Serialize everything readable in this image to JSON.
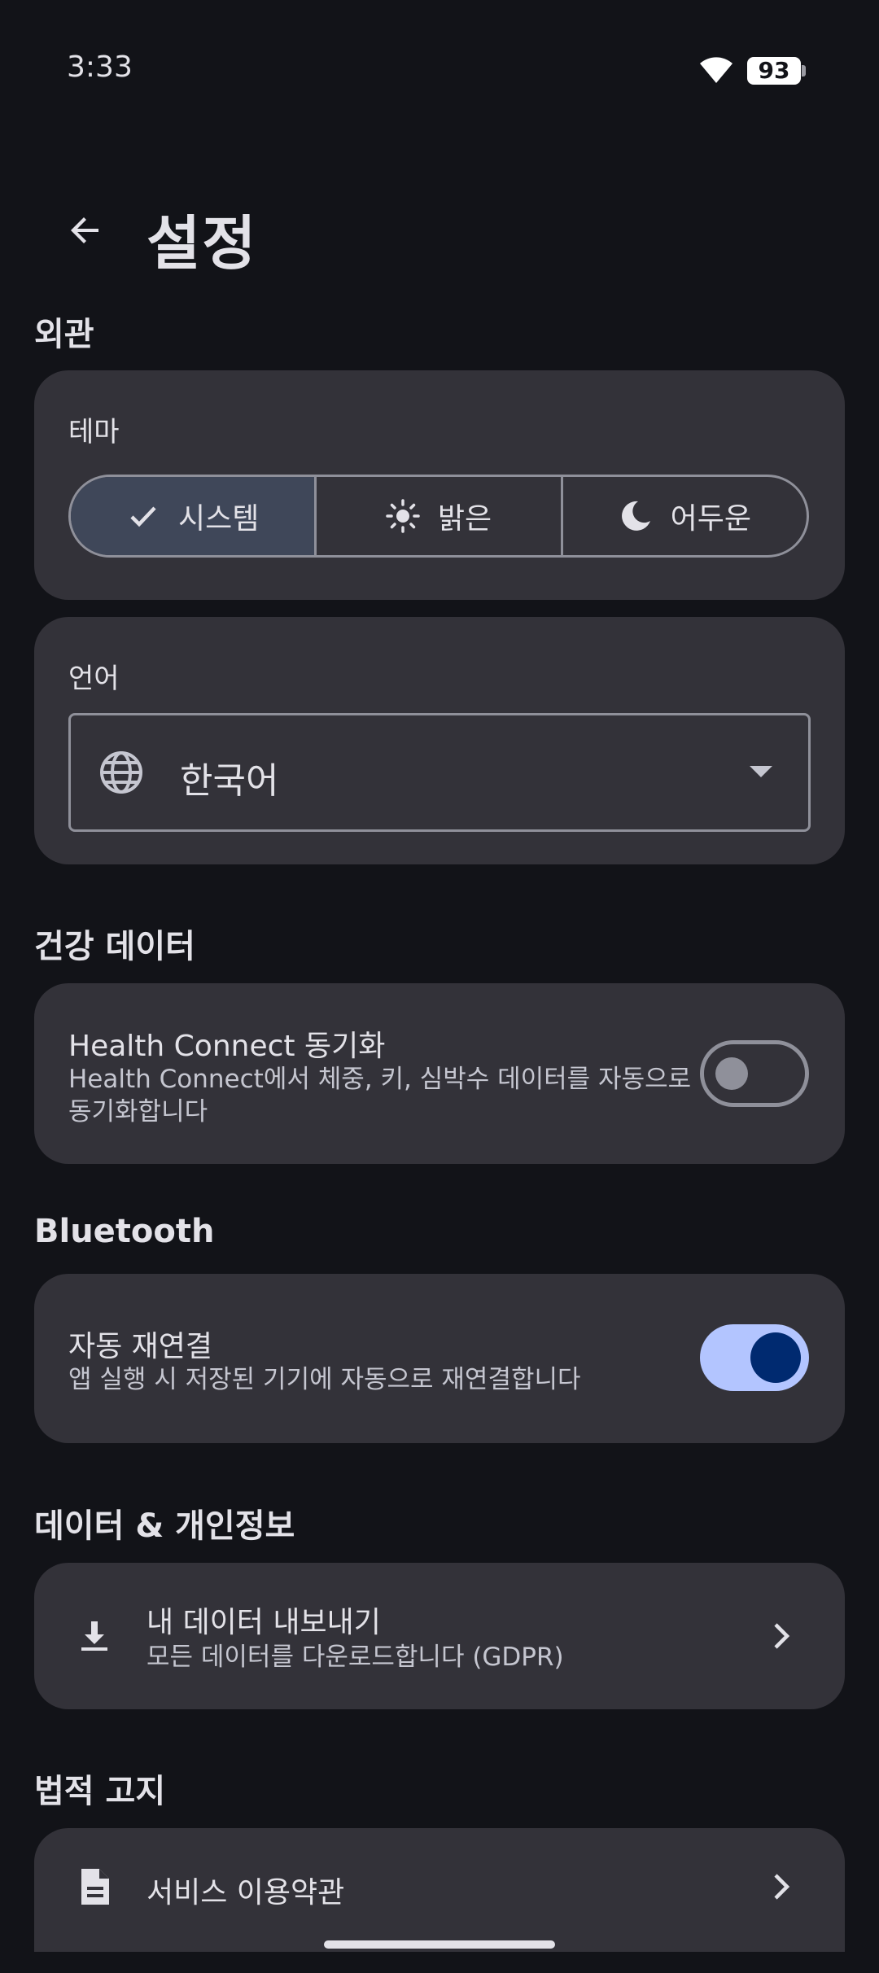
{
  "status": {
    "time": "3:33",
    "battery": "93"
  },
  "header": {
    "title": "설정"
  },
  "appearance": {
    "section_title": "외관",
    "theme_label": "테마",
    "theme_options": [
      {
        "label": "시스템",
        "icon": "check-icon",
        "selected": true
      },
      {
        "label": "밝은",
        "icon": "sun-icon",
        "selected": false
      },
      {
        "label": "어두운",
        "icon": "moon-icon",
        "selected": false
      }
    ],
    "language_label": "언어",
    "language_value": "한국어"
  },
  "health": {
    "section_title": "건강 데이터",
    "sync_title": "Health Connect 동기화",
    "sync_desc_line1": "Health Connect에서 체중, 키, 심박수 데이터를 자동으로",
    "sync_desc_line2": "동기화합니다",
    "sync_enabled": false
  },
  "bluetooth": {
    "section_title": "Bluetooth",
    "reconnect_title": "자동 재연결",
    "reconnect_desc": "앱 실행 시 저장된 기기에 자동으로 재연결합니다",
    "reconnect_enabled": true
  },
  "privacy": {
    "section_title": "데이터 & 개인정보",
    "export_title": "내 데이터 내보내기",
    "export_desc": "모든 데이터를 다운로드합니다 (GDPR)"
  },
  "legal": {
    "section_title": "법적 고지",
    "terms_title": "서비스 이용약관"
  },
  "colors": {
    "background": "#121318",
    "card": "#333239",
    "selected_segment": "#3f4759",
    "switch_on_track": "#b3c5ff",
    "switch_on_knob": "#002a70"
  }
}
